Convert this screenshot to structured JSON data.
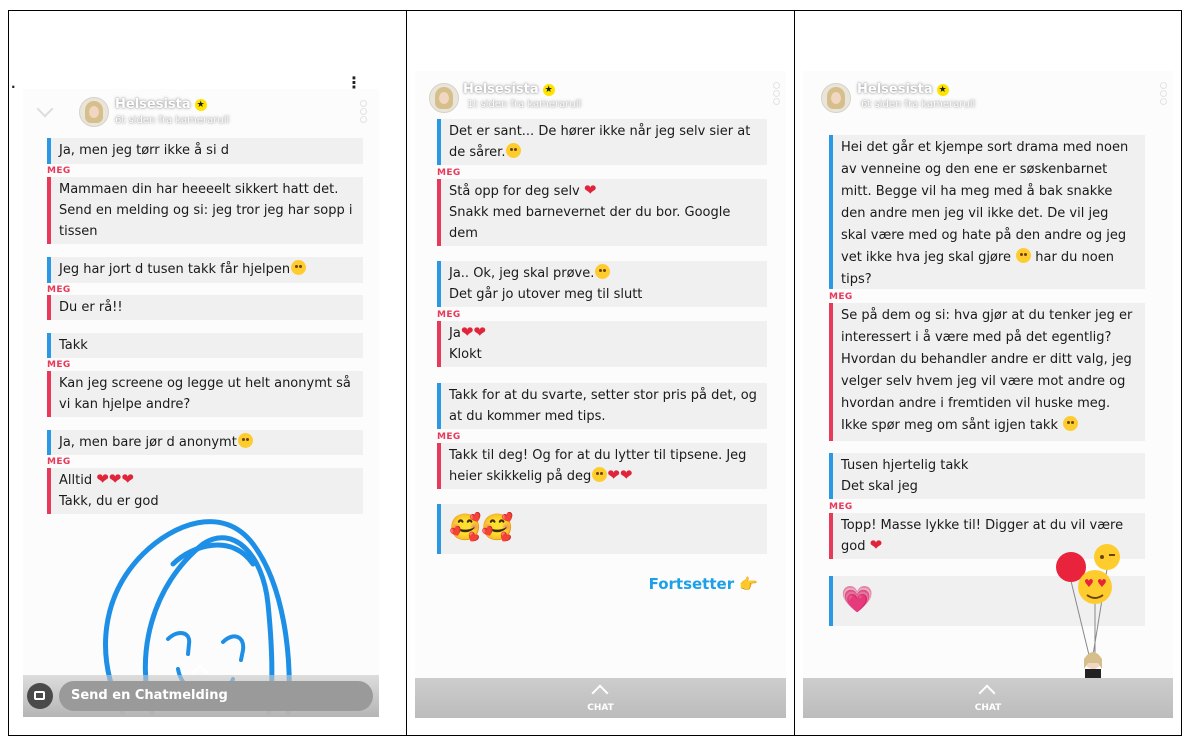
{
  "panels": [
    {
      "contact": "Helsesista",
      "subtitle": "6t siden fra kamerarull",
      "menu_dots": "⋮",
      "sender_label": "MEG",
      "messages": [
        {
          "text": "Ja, men jeg tørr ikke å si d"
        },
        {
          "text": "Mammaen din har heeeelt sikkert hatt det. Send en melding og si: jeg tror jeg har sopp i tissen"
        },
        {
          "text": "Jeg har jort d tusen takk får hjelpen"
        },
        {
          "text": "Du er rå!!"
        },
        {
          "text": "Takk"
        },
        {
          "text": "Kan jeg screene og legge ut helt anonymt så vi kan hjelpe andre?"
        },
        {
          "text": "Ja, men bare jør d anonymt"
        },
        {
          "line1": "Alltid",
          "line2": "Takk, du er god"
        }
      ],
      "composer_placeholder": "Send en Chatmelding"
    },
    {
      "contact": "Helsesista",
      "subtitle": "1t siden fra kamerarull",
      "sender_label": "MEG",
      "messages": [
        {
          "text": "Det er sant... De hører ikke når jeg selv sier at de sårer."
        },
        {
          "line1": "Stå opp for deg selv",
          "line2": "Snakk med barnevernet der du bor. Google dem"
        },
        {
          "line1": "Ja.. Ok, jeg skal prøve.",
          "line2": "Det går jo utover meg til slutt"
        },
        {
          "line1": "Ja",
          "line2": "Klokt"
        },
        {
          "text": "Takk for at du svarte, setter stor pris på det, og at du kommer med tips."
        },
        {
          "text": "Takk til deg! Og for at du lytter til tipsene. Jeg heier skikkelig på deg"
        },
        {
          "text": "🥰🥰"
        }
      ],
      "continue_label": "Fortsetter 👉",
      "bottom_label": "CHAT"
    },
    {
      "contact": "Helsesista",
      "subtitle": "6t siden fra kamerarull",
      "sender_label": "MEG",
      "messages": [
        {
          "text": "Hei det går et kjempe sort drama med noen av venneine og den ene er søskenbarnet mitt. Begge vil ha meg med å bak snakke den andre men jeg vil ikke det. De vil jeg skal være med og hate på den andre og jeg vet ikke hva jeg skal gjøre"
        },
        {
          "text_tail": "har du noen tips?"
        },
        {
          "text": "Se på dem og si: hva gjør at du tenker jeg er interessert i å være med på det egentlig? Hvordan du behandler andre er ditt valg, jeg velger selv hvem jeg vil være mot andre og hvordan andre i fremtiden vil huske meg. Ikke spør meg om sånt igjen takk"
        },
        {
          "line1": "Tusen hjertelig takk",
          "line2": "Det skal jeg"
        },
        {
          "text": "Topp! Masse lykke til! Digger at du vil være god"
        },
        {
          "text": "💗"
        }
      ],
      "bottom_label": "CHAT"
    }
  ],
  "colors": {
    "them_accent": "#2b98e6",
    "me_accent": "#e8395a",
    "link_blue": "#1da0e8",
    "doodle_blue": "#1e8fe6"
  }
}
